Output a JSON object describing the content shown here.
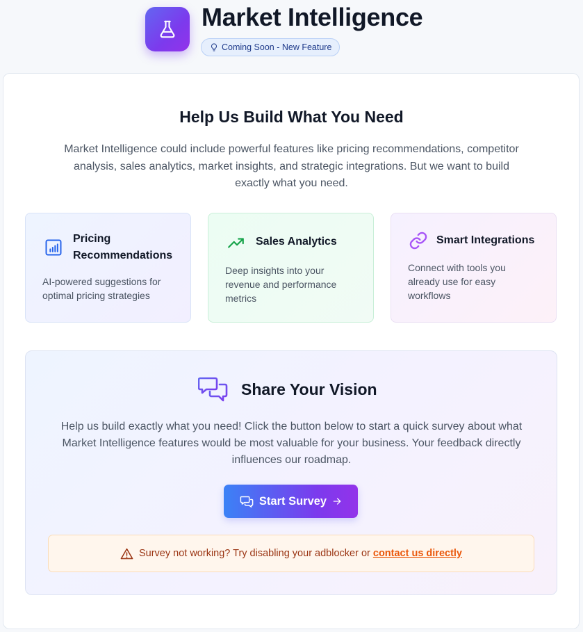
{
  "header": {
    "title": "Market Intelligence",
    "badge": "Coming Soon - New Feature",
    "logo_icon": "flask-icon",
    "badge_icon": "lightbulb-icon"
  },
  "intro": {
    "heading": "Help Us Build What You Need",
    "description": "Market Intelligence could include powerful features like pricing recommendations, competitor analysis, sales analytics, market insights, and strategic integrations. But we want to build exactly what you need."
  },
  "features": [
    {
      "title": "Pricing Recommendations",
      "description": "AI-powered suggestions for optimal pricing strategies",
      "icon": "bar-chart-icon",
      "accent": "#2563eb"
    },
    {
      "title": "Sales Analytics",
      "description": "Deep insights into your revenue and performance metrics",
      "icon": "trending-up-icon",
      "accent": "#16a34a"
    },
    {
      "title": "Smart Integrations",
      "description": "Connect with tools you already use for easy workflows",
      "icon": "link-icon",
      "accent": "#a855f7"
    }
  ],
  "vision": {
    "heading": "Share Your Vision",
    "description": "Help us build exactly what you need! Click the button below to start a quick survey about what Market Intelligence features would be most valuable for your business. Your feedback directly influences our roadmap.",
    "icon": "chat-bubbles-icon",
    "button_label": "Start Survey",
    "warning_text": "Survey not working? Try disabling your adblocker or",
    "warning_link": "contact us directly"
  },
  "colors": {
    "brand_gradient_start": "#3b82f6",
    "brand_gradient_end": "#9333ea",
    "warning_text": "#9a3412",
    "warning_link": "#ea580c"
  }
}
